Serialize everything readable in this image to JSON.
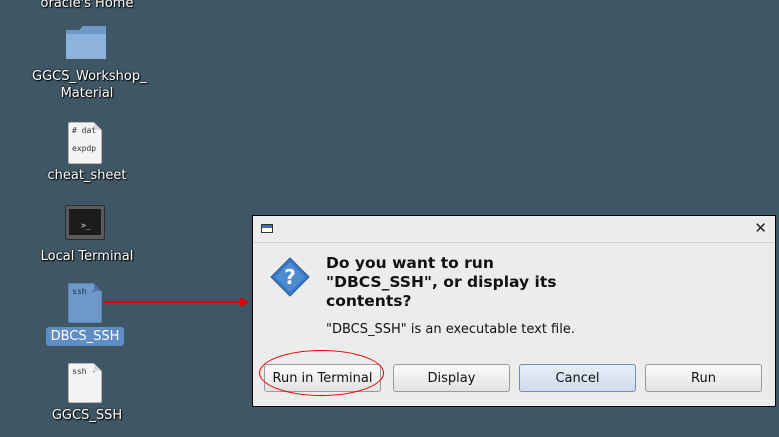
{
  "desktop": {
    "icons": [
      {
        "label": "oracle's Home"
      },
      {
        "label": "GGCS_Workshop_\nMaterial"
      },
      {
        "label": "cheat_sheet",
        "file_lines": [
          "# dat",
          "expdp"
        ]
      },
      {
        "label": "Local Terminal",
        "glyph": ">_"
      },
      {
        "label": "DBCS_SSH",
        "file_lines": [
          "ssh -"
        ]
      },
      {
        "label": "GGCS_SSH",
        "file_lines": [
          "ssh -"
        ]
      }
    ]
  },
  "dialog": {
    "title": "",
    "heading": "Do you want to run\n\"DBCS_SSH\", or display its\ncontents?",
    "message": "\"DBCS_SSH\" is an executable text file.",
    "close_glyph": "✕",
    "buttons": {
      "run_in_terminal": "Run in Terminal",
      "display": "Display",
      "cancel": "Cancel",
      "run": "Run"
    }
  },
  "annotations": {
    "arrow_color": "#e00000",
    "ellipse_color": "#e00000"
  },
  "colors": {
    "desktop_background": "#3f5764",
    "selection": "#5f8dc4",
    "folder": "#7fa6d4"
  }
}
